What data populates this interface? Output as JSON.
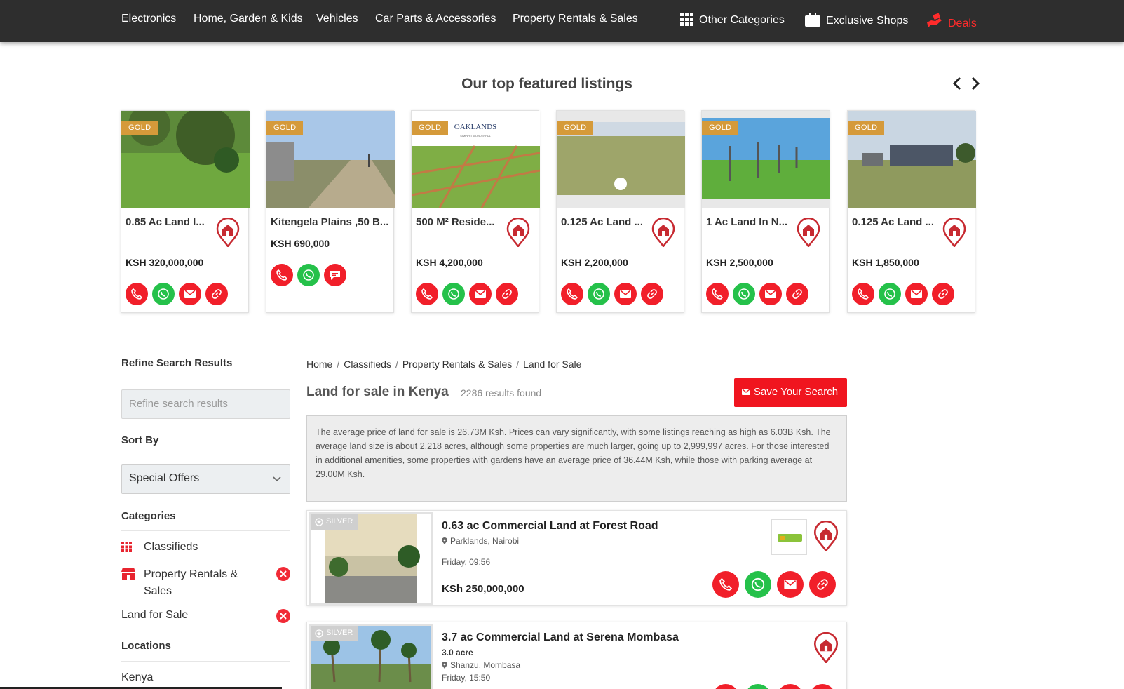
{
  "nav": {
    "items": [
      "Electronics",
      "Home, Garden & Kids",
      "Vehicles",
      "Car Parts & Accessories",
      "Property Rentals & Sales"
    ],
    "other_categories": "Other Categories",
    "exclusive_shops": "Exclusive Shops",
    "deals": "Deals"
  },
  "featured": {
    "title": "Our top featured listings",
    "badge": "GOLD",
    "cards": [
      {
        "title": "0.85 Ac Land I...",
        "price": "KSH 320,000,000"
      },
      {
        "title": "Kitengela Plains ,50 B...",
        "price": "KSH 690,000"
      },
      {
        "title": "500 M² Reside...",
        "price": "KSH 4,200,000",
        "logo_text": "OAKLANDS",
        "logo_sub": "SIMPLY • WONDERFUL"
      },
      {
        "title": "0.125 Ac Land ...",
        "price": "KSH 2,200,000"
      },
      {
        "title": "1 Ac Land In N...",
        "price": "KSH 2,500,000"
      },
      {
        "title": "0.125 Ac Land ...",
        "price": "KSH 1,850,000"
      }
    ]
  },
  "sidebar": {
    "refine_heading": "Refine Search Results",
    "refine_placeholder": "Refine search results",
    "sort_heading": "Sort By",
    "sort_value": "Special Offers",
    "categories_heading": "Categories",
    "categories": [
      {
        "label": "Classifieds"
      },
      {
        "label": "Property Rentals &",
        "label2": "Sales"
      },
      {
        "label": "Land for Sale"
      }
    ],
    "locations_heading": "Locations",
    "location": "Kenya"
  },
  "main": {
    "breadcrumbs": [
      "Home",
      "Classifieds",
      "Property Rentals & Sales",
      "Land for Sale"
    ],
    "breadcrumb_sep": "/",
    "title": "Land for sale in Kenya",
    "results": "2286 results found",
    "save_search": "Save Your Search",
    "summary": "The average price of land for sale is 26.73M Ksh. Prices can vary significantly, with some listings reaching as high as 6.03B Ksh. The average land size is about 2,218 acres, although some properties are much larger, going up to 2,999,997 acres. For those interested in additional amenities, some properties with gardens have an average price of 36.44M Ksh, while those with parking average at 29.00M Ksh.",
    "listings": [
      {
        "badge": "SILVER",
        "title": "0.63 ac Commercial Land at Forest Road",
        "location": "Parklands, Nairobi",
        "date": "Friday, 09:56",
        "price": "KSh 250,000,000"
      },
      {
        "badge": "SILVER",
        "title": "3.7 ac Commercial Land at Serena Mombasa",
        "size": "3.0 acre",
        "location": "Shanzu, Mombasa",
        "date": "Friday, 15:50"
      }
    ]
  },
  "colors": {
    "accent_red": "#f0151f",
    "gold": "#d59a3a",
    "whatsapp_green": "#25c14a",
    "nav_bg": "#2e2e2e"
  }
}
